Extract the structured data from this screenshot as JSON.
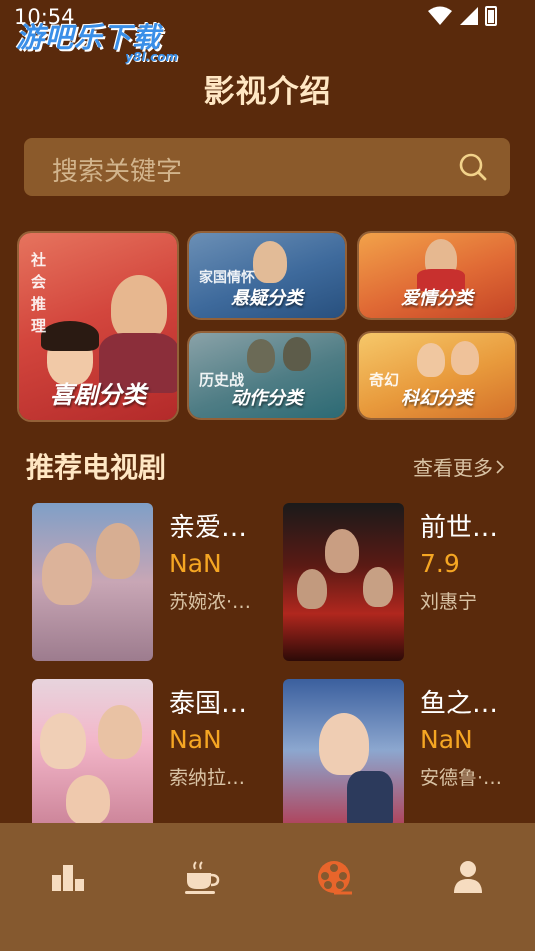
{
  "status_bar": {
    "time": "10:54"
  },
  "watermark": {
    "text": "游吧乐下载",
    "sub": "y8l.com"
  },
  "page": {
    "title": "影视介绍"
  },
  "search": {
    "placeholder": "搜索关键字"
  },
  "categories": [
    {
      "label": "喜剧分类",
      "tag": "社会推理"
    },
    {
      "label": "悬疑分类",
      "tag": "家国情怀"
    },
    {
      "label": "爱情分类",
      "tag": ""
    },
    {
      "label": "动作分类",
      "tag": "历史战"
    },
    {
      "label": "科幻分类",
      "tag": "奇幻"
    }
  ],
  "section": {
    "title": "推荐电视剧",
    "see_more": "查看更多"
  },
  "dramas": [
    {
      "title": "亲爱…",
      "score": "NaN",
      "cast": "苏婉浓·…"
    },
    {
      "title": "前世…",
      "score": "7.9",
      "cast": "刘惠宁"
    },
    {
      "title": "泰国…",
      "score": "NaN",
      "cast": "索纳拉…"
    },
    {
      "title": "鱼之…",
      "score": "NaN",
      "cast": "安德鲁·…"
    }
  ],
  "colors": {
    "background": "#5a2a0c",
    "search_bg": "#8b5a2b",
    "nav_bg": "#85592f",
    "accent": "#e8652b",
    "score": "#f5a623"
  },
  "nav": {
    "items": [
      {
        "icon": "ranking-icon",
        "active": false
      },
      {
        "icon": "coffee-icon",
        "active": false
      },
      {
        "icon": "film-reel-icon",
        "active": true
      },
      {
        "icon": "user-icon",
        "active": false
      }
    ]
  }
}
